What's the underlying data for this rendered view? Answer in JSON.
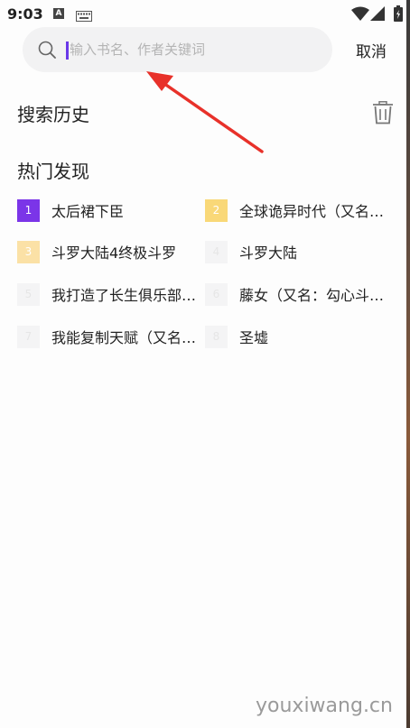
{
  "status_bar": {
    "time": "9:03",
    "a_icon_label": "A"
  },
  "search": {
    "placeholder": "输入书名、作者关键词",
    "value": "",
    "cancel_label": "取消"
  },
  "history": {
    "title": "搜索历史"
  },
  "hot": {
    "title": "热门发现",
    "items": [
      {
        "rank": "1",
        "title": "太后裙下臣"
      },
      {
        "rank": "2",
        "title": "全球诡异时代（又名…"
      },
      {
        "rank": "3",
        "title": "斗罗大陆4终极斗罗"
      },
      {
        "rank": "4",
        "title": "斗罗大陆"
      },
      {
        "rank": "5",
        "title": "我打造了长生俱乐部…"
      },
      {
        "rank": "6",
        "title": "藤女（又名：勾心斗…"
      },
      {
        "rank": "7",
        "title": "我能复制天赋（又名…"
      },
      {
        "rank": "8",
        "title": "圣墟"
      }
    ]
  },
  "watermark": "youxiwang.cn",
  "colors": {
    "accent": "#7b35e8",
    "rank2": "#f9d878",
    "rank3": "#fbe1a6",
    "annotation_arrow": "#e8312a"
  }
}
